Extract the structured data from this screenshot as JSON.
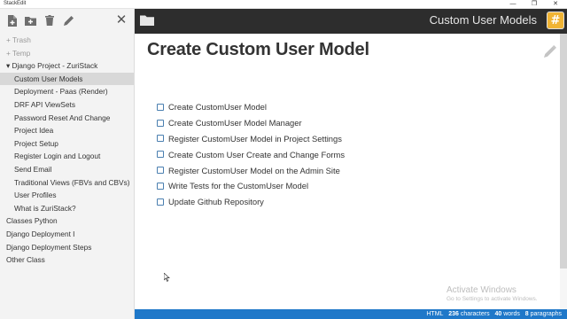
{
  "window": {
    "title": "StackEdit",
    "controls": {
      "minimize": "—",
      "maximize": "❐",
      "close": "✕"
    }
  },
  "sidebar": {
    "toolbar": {
      "icons": [
        "new-file-icon",
        "new-folder-icon",
        "trash-icon",
        "rename-icon"
      ],
      "close_glyph": "✕"
    },
    "items": [
      {
        "label": "+ Trash",
        "kind": "folder",
        "dim": true
      },
      {
        "label": "+ Temp",
        "kind": "folder",
        "dim": true
      },
      {
        "label": "▾ Django Project - ZuriStack",
        "kind": "folder",
        "dim": false
      },
      {
        "label": "Custom User Models",
        "kind": "child",
        "selected": true
      },
      {
        "label": "Deployment - Paas (Render)",
        "kind": "child"
      },
      {
        "label": "DRF API ViewSets",
        "kind": "child"
      },
      {
        "label": "Password Reset And Change",
        "kind": "child"
      },
      {
        "label": "Project Idea",
        "kind": "child"
      },
      {
        "label": "Project Setup",
        "kind": "child"
      },
      {
        "label": "Register Login and Logout",
        "kind": "child"
      },
      {
        "label": "Send Email",
        "kind": "child"
      },
      {
        "label": "Traditional Views (FBVs and CBVs)",
        "kind": "child"
      },
      {
        "label": "User Profiles",
        "kind": "child"
      },
      {
        "label": "What is ZuriStack?",
        "kind": "child"
      },
      {
        "label": "Classes Python",
        "kind": "root"
      },
      {
        "label": "Django Deployment I",
        "kind": "root"
      },
      {
        "label": "Django Deployment Steps",
        "kind": "root"
      },
      {
        "label": "Other Class",
        "kind": "root"
      }
    ]
  },
  "navbar": {
    "title": "Custom User Models",
    "menu_glyph": "#"
  },
  "editor": {
    "heading": "Create Custom User Model",
    "tasks": [
      "Create CustomUser Model",
      "Create CustomUser Model Manager",
      "Register CustomUser Model in Project Settings",
      "Create Custom User Create and Change Forms",
      "Register CustomUser Model on the Admin Site",
      "Write Tests for the CustomUser Model",
      "Update Github Repository"
    ],
    "watermark": {
      "line1": "Activate Windows",
      "line2": "Go to Settings to activate Windows."
    }
  },
  "statusbar": {
    "mode": "HTML",
    "characters": "236",
    "characters_label": "characters",
    "words": "40",
    "words_label": "words",
    "paragraphs": "8",
    "paragraphs_label": "paragraphs"
  },
  "colors": {
    "navbar_bg": "#2d2d2d",
    "statusbar_bg": "#1f78c9",
    "menu_button": "#f0b434",
    "checkbox_border": "#4a7fb0",
    "sidebar_selected": "#d8d8d8"
  }
}
